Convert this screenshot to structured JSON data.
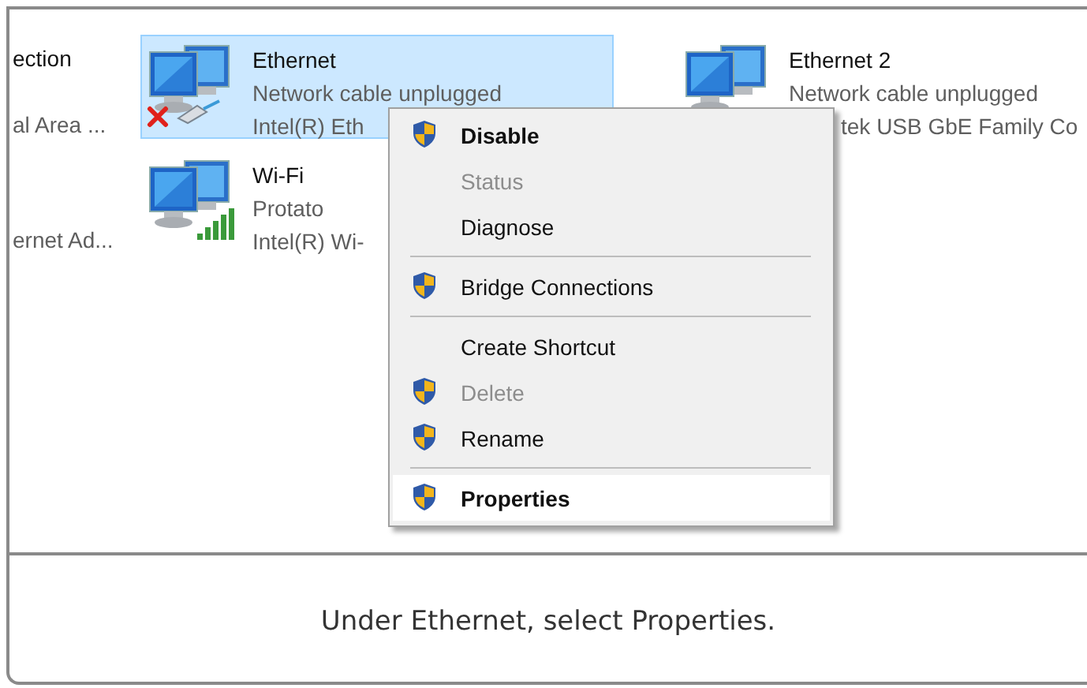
{
  "left_partial": [
    {
      "name": "ection",
      "device": "al Area ..."
    },
    {
      "device": "ernet Ad..."
    }
  ],
  "adapters": [
    {
      "name": "Ethernet",
      "status": "Network cable unplugged",
      "device": "Intel(R) Eth",
      "selected": true,
      "kind": "unplugged"
    },
    {
      "name": "Wi-Fi",
      "status": "Protato",
      "device": "Intel(R) Wi-",
      "selected": false,
      "kind": "wifi"
    },
    {
      "name": "Ethernet 2",
      "status": "Network cable unplugged",
      "device": "tek USB GbE Family Co",
      "selected": false,
      "kind": "plain"
    }
  ],
  "context_menu": {
    "items": [
      {
        "kind": "item",
        "label": "Disable",
        "shield": true,
        "disabled": false,
        "default": true,
        "selected": false
      },
      {
        "kind": "item",
        "label": "Status",
        "shield": false,
        "disabled": true,
        "default": false,
        "selected": false
      },
      {
        "kind": "item",
        "label": "Diagnose",
        "shield": false,
        "disabled": false,
        "default": false,
        "selected": false
      },
      {
        "kind": "separator"
      },
      {
        "kind": "item",
        "label": "Bridge Connections",
        "shield": true,
        "disabled": false,
        "default": false,
        "selected": false
      },
      {
        "kind": "separator"
      },
      {
        "kind": "item",
        "label": "Create Shortcut",
        "shield": false,
        "disabled": false,
        "default": false,
        "selected": false
      },
      {
        "kind": "item",
        "label": "Delete",
        "shield": true,
        "disabled": true,
        "default": false,
        "selected": false
      },
      {
        "kind": "item",
        "label": "Rename",
        "shield": true,
        "disabled": false,
        "default": false,
        "selected": false
      },
      {
        "kind": "separator"
      },
      {
        "kind": "item",
        "label": "Properties",
        "shield": true,
        "disabled": false,
        "default": true,
        "selected": true
      }
    ]
  },
  "caption": "Under Ethernet, select Properties."
}
